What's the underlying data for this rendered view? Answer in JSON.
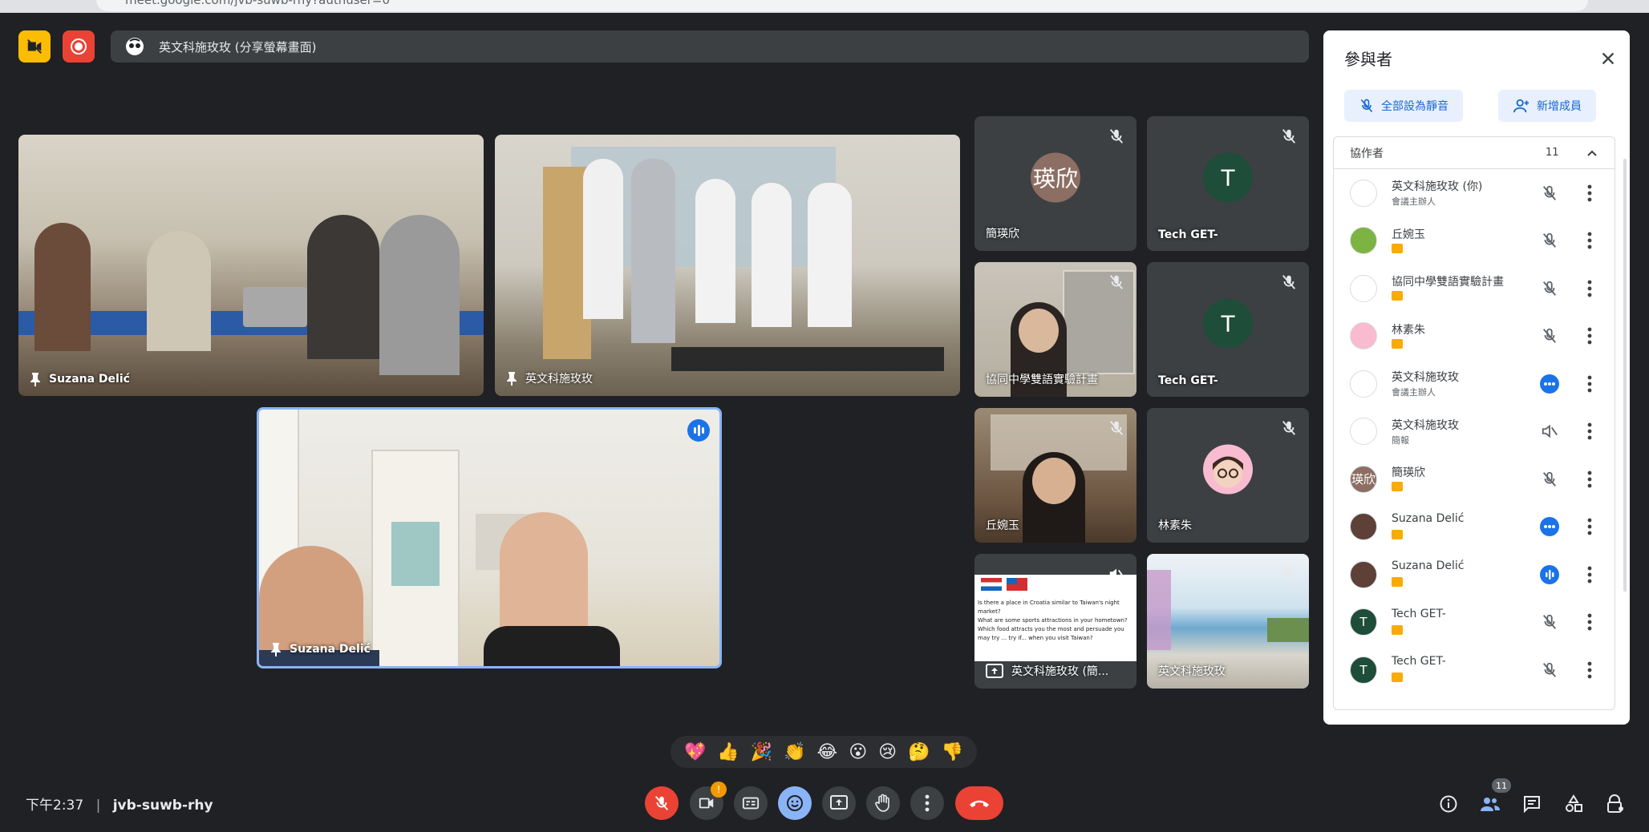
{
  "browser": {
    "url": "meet.google.com/jvb-suwb-rhy?authuser=0"
  },
  "top": {
    "presenting_label": "英文科施玫玫 (分享螢幕畫面)"
  },
  "tiles": {
    "t1": {
      "name": "Suzana Delić"
    },
    "t2": {
      "name": "英文科施玫玫"
    },
    "t3": {
      "name": "Suzana Delić"
    },
    "s1": {
      "name": "簡瑛欣",
      "initials": "瑛欣"
    },
    "s2": {
      "name": "Tech GET-",
      "initials": "T"
    },
    "s3": {
      "name": "協同中學雙語實驗計畫"
    },
    "s4": {
      "name": "Tech GET-",
      "initials": "T"
    },
    "s5": {
      "name": "丘婉玉"
    },
    "s6": {
      "name": "林素朱"
    },
    "s7": {
      "name": "英文科施玫玫 (簡..."
    },
    "s8": {
      "name": "英文科施玫玫"
    }
  },
  "slide": {
    "l1": "Is there a place in Croatia similar to Taiwan's night market?",
    "l2": "What are some sports attractions in your hometown?",
    "l3": "Which food attracts you the most and persuade you may try ... try if... when you visit Taiwan?"
  },
  "panel": {
    "title": "參與者",
    "mute_all": "全部設為靜音",
    "add_people": "新增成員",
    "group_label": "協作者",
    "group_count": "11",
    "participants": [
      {
        "name": "英文科施玫玫 (你)",
        "sub": "會議主辦人",
        "initials": "",
        "avatar_color": "#ffffff"
      },
      {
        "name": "丘婉玉",
        "sub": "",
        "initials": "",
        "avatar_color": "#7cb342"
      },
      {
        "name": "協同中學雙語實驗計畫",
        "sub": "",
        "initials": "",
        "avatar_color": "#ffffff"
      },
      {
        "name": "林素朱",
        "sub": "",
        "initials": "",
        "avatar_color": "#f8bbd0"
      },
      {
        "name": "英文科施玫玫",
        "sub": "會議主辦人",
        "initials": "",
        "avatar_color": "#ffffff"
      },
      {
        "name": "英文科施玫玫",
        "sub": "簡報",
        "initials": "",
        "avatar_color": "#ffffff"
      },
      {
        "name": "簡瑛欣",
        "sub": "",
        "initials": "瑛欣",
        "avatar_color": "#8d6e63"
      },
      {
        "name": "Suzana Delić",
        "sub": "",
        "initials": "",
        "avatar_color": "#5d4037"
      },
      {
        "name": "Suzana Delić",
        "sub": "",
        "initials": "",
        "avatar_color": "#5d4037"
      },
      {
        "name": "Tech GET-",
        "sub": "",
        "initials": "T",
        "avatar_color": "#1e4d3a"
      },
      {
        "name": "Tech GET-",
        "sub": "",
        "initials": "T",
        "avatar_color": "#1e4d3a"
      }
    ]
  },
  "bottom": {
    "time": "下午2:37",
    "meeting_code": "jvb-suwb-rhy",
    "participant_count": "11",
    "camera_alert": "!",
    "reactions": [
      "💖",
      "👍",
      "🎉",
      "👏",
      "😂",
      "😮",
      "😢",
      "🤔",
      "👎"
    ]
  },
  "colors": {
    "bg": "#202124",
    "tile": "#3c4043",
    "accent": "#1a73e8",
    "end_call": "#ea4335",
    "highlight": "#8ab4f8"
  }
}
